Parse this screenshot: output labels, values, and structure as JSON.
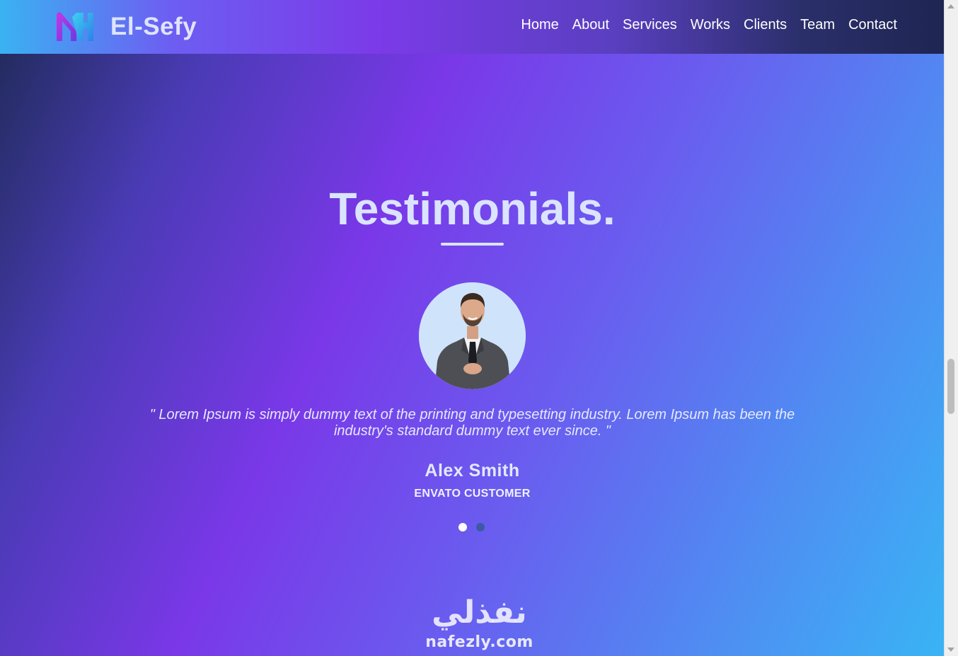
{
  "brand": {
    "name": "El-Sefy",
    "logo_icon": "el-sefy-logo-icon"
  },
  "nav": {
    "items": [
      {
        "label": "Home"
      },
      {
        "label": "About"
      },
      {
        "label": "Services"
      },
      {
        "label": "Works"
      },
      {
        "label": "Clients"
      },
      {
        "label": "Team"
      },
      {
        "label": "Contact"
      }
    ]
  },
  "testimonials": {
    "title": "Testimonials.",
    "quote": "\" Lorem Ipsum is simply dummy text of the printing and typesetting industry. Lorem Ipsum has been the industry's standard dummy text ever since. \"",
    "name": "Alex Smith",
    "role": "ENVATO CUSTOMER",
    "slides": [
      {
        "active": true
      },
      {
        "active": false
      }
    ]
  },
  "watermark": {
    "arabic": "نفذلي",
    "latin": "nafezly.com"
  },
  "colors": {
    "accent_light": "#dbe4ff",
    "gradient_start": "#1e2a55",
    "gradient_mid": "#7a38e8",
    "gradient_end": "#38b6f5",
    "dot_inactive": "#3b5aa5"
  }
}
